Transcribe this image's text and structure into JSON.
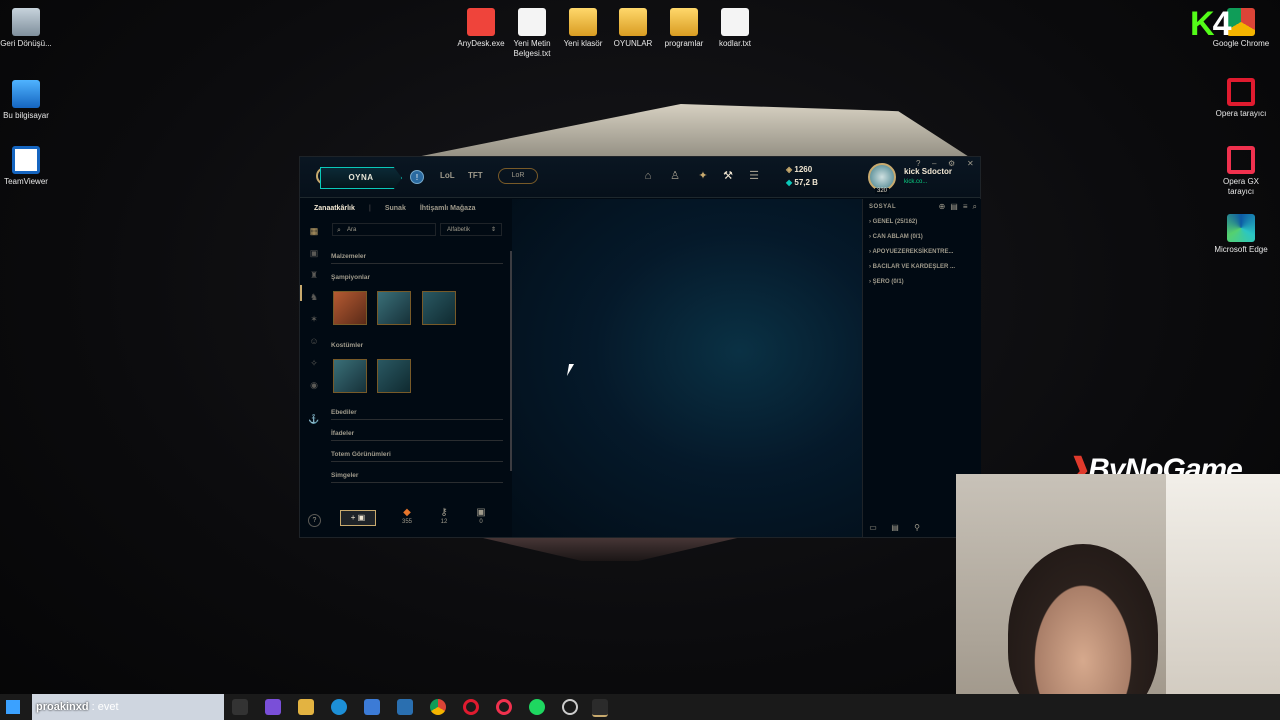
{
  "desktop": {
    "left_icons": [
      {
        "label": "Geri Dönüşü...",
        "icon": "recycle-bin-icon"
      },
      {
        "label": "Bu bilgisayar",
        "icon": "computer-icon"
      },
      {
        "label": "TeamViewer",
        "icon": "teamviewer-icon"
      }
    ],
    "top_icons": [
      {
        "label": "AnyDesk.exe",
        "icon": "anydesk-icon"
      },
      {
        "label": "Yeni Metin Belgesi.txt",
        "icon": "text-file-icon"
      },
      {
        "label": "Yeni klasör",
        "icon": "folder-icon"
      },
      {
        "label": "OYUNLAR",
        "icon": "folder-icon"
      },
      {
        "label": "programlar",
        "icon": "folder-icon"
      },
      {
        "label": "kodlar.txt",
        "icon": "text-file-icon"
      }
    ],
    "right_icons": [
      {
        "label": "Google Chrome",
        "icon": "chrome-icon"
      },
      {
        "label": "Opera tarayıcı",
        "icon": "opera-icon"
      },
      {
        "label": "Opera GX tarayıcı",
        "icon": "opera-gx-icon"
      },
      {
        "label": "Microsoft Edge",
        "icon": "edge-icon"
      }
    ]
  },
  "client": {
    "play_label": "OYNA",
    "nav": {
      "lol": "LoL",
      "tft": "TFT",
      "lor": "LoR"
    },
    "currency": {
      "rp": "1260",
      "be": "57,2 B"
    },
    "profile": {
      "name": "kick Sdoctor",
      "status": "kick.co...",
      "level": "320"
    },
    "subnav": {
      "crafting": "Zanaatkârlık",
      "altar": "Sunak",
      "store": "İhtişamlı Mağaza"
    },
    "search_placeholder": "Ara",
    "sort_label": "Alfabetik",
    "sections": {
      "materials": "Malzemeler",
      "champions": "Şampiyonlar",
      "skins": "Kostümler",
      "eternals": "Ebediler",
      "emotes": "İfadeler",
      "ward_skins": "Totem Görünümleri",
      "icons": "Simgeler"
    },
    "resources": {
      "essence_orange": "355",
      "key_fragments": "12",
      "chests": "0"
    },
    "social": {
      "header": "SOSYAL",
      "groups": [
        "GENEL (25/162)",
        "CAN ABLAM (0/1)",
        "APOYUEZEREKSİKENTRE...",
        "BACILAR VE KARDEŞLER ...",
        "ŞERO (0/1)"
      ]
    }
  },
  "overlays": {
    "brand": "ByNoGame",
    "kick_badge": "K",
    "kick_number": "4",
    "chat_user": "proakinxd",
    "chat_message": ": evet"
  },
  "colors": {
    "gold": "#c8aa6e",
    "teal": "#0ac8b9",
    "bg": "#010a13"
  }
}
